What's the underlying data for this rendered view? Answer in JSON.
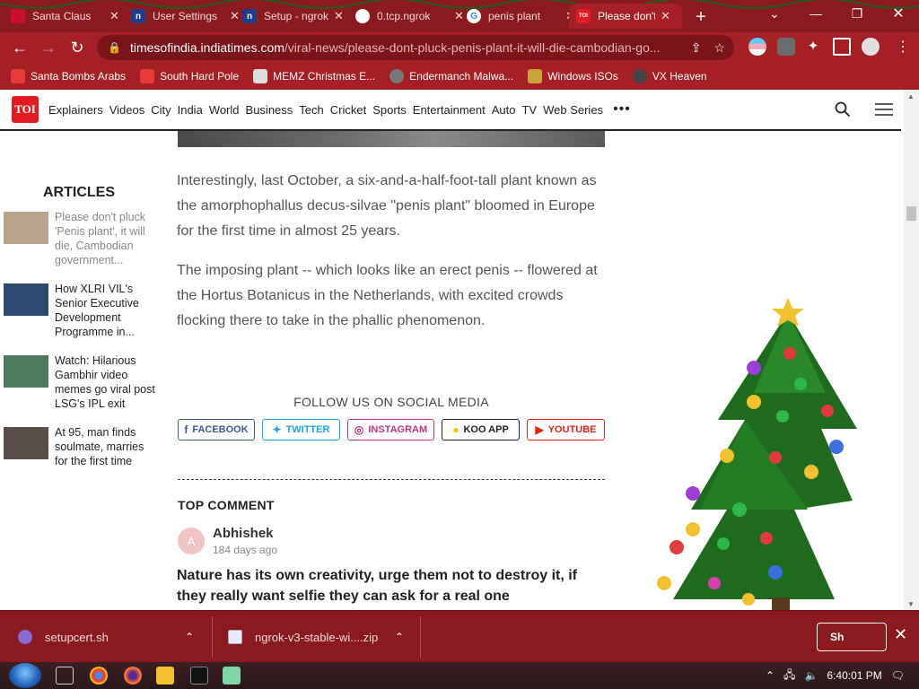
{
  "browser": {
    "tabs": [
      {
        "label": "Santa Claus",
        "fav_color": "#c8102e",
        "fav_text": ""
      },
      {
        "label": "User Settings",
        "fav_color": "#1f3b8c",
        "fav_text": "n"
      },
      {
        "label": "Setup - ngrok",
        "fav_color": "#1f3b8c",
        "fav_text": "n"
      },
      {
        "label": "0.tcp.ngrok",
        "fav_color": "#ffffff",
        "fav_text": ""
      },
      {
        "label": "penis plant",
        "fav_color": "#ffffff",
        "fav_text": "G"
      },
      {
        "label": "Please don't",
        "fav_color": "#e21b22",
        "fav_text": "TOI"
      }
    ],
    "url_domain": "timesofindia.indiatimes.com",
    "url_path": "/viral-news/please-dont-pluck-penis-plant-it-will-die-cambodian-go...",
    "bookmarks": [
      {
        "label": "Santa Bombs Arabs",
        "color": "#e63b3b"
      },
      {
        "label": "South Hard Pole",
        "color": "#e63b3b"
      },
      {
        "label": "MEMZ Christmas E...",
        "color": "#ddd"
      },
      {
        "label": "Endermanch Malwa...",
        "color": "#777"
      },
      {
        "label": "Windows ISOs",
        "color": "#c9a23a"
      },
      {
        "label": "VX Heaven",
        "color": "#444"
      }
    ],
    "colors": {
      "frame": "#8b1a1e",
      "toolbar": "#a51f24",
      "omnibox": "#7a1418"
    }
  },
  "site": {
    "logo_text": "TOI",
    "nav": [
      "Explainers",
      "Videos",
      "City",
      "India",
      "World",
      "Business",
      "Tech",
      "Cricket",
      "Sports",
      "Entertainment",
      "Auto",
      "TV",
      "Web Series"
    ],
    "more_label": "•••",
    "brand_color": "#e21b22"
  },
  "sidebar": {
    "title": "ARTICLES",
    "items": [
      {
        "text": "Please don't pluck 'Penis plant', it will die, Cambodian government...",
        "thumb": "#b9a58a"
      },
      {
        "text": "How XLRI VIL's Senior Executive Development Programme in...",
        "thumb": "#2d4b6e"
      },
      {
        "text": "Watch: Hilarious Gambhir video memes go viral post LSG's IPL exit",
        "thumb": "#4d7a5c"
      },
      {
        "text": "At 95, man finds soulmate, marries for the first time",
        "thumb": "#5a4e4a"
      }
    ]
  },
  "article": {
    "paragraphs": [
      "Interestingly, last October, a six-and-a-half-foot-tall plant known as the amorphophallus decus-silvae \"penis plant\" bloomed in Europe for the first time in almost 25 years.",
      "The imposing plant -- which looks like an erect penis -- flowered at the Hortus Botanicus in the Netherlands, with excited crowds flocking there to take in the phallic phenomenon."
    ],
    "follow_label": "FOLLOW US ON SOCIAL MEDIA",
    "social": [
      {
        "label": "FACEBOOK",
        "icon": "f",
        "color": "#3b5998"
      },
      {
        "label": "TWITTER",
        "icon": "🐦",
        "color": "#1da1f2"
      },
      {
        "label": "INSTAGRAM",
        "icon": "◎",
        "color": "#c13584"
      },
      {
        "label": "KOO APP",
        "icon": "●",
        "color": "#222222"
      },
      {
        "label": "YOUTUBE",
        "icon": "▶",
        "color": "#e62117"
      }
    ],
    "top_comment_label": "TOP COMMENT",
    "comment": {
      "avatar_letter": "A",
      "author": "Abhishek",
      "time": "184 days ago",
      "text": "Nature has its own creativity, urge them not to destroy it, if they really want selfie they can ask for a real one"
    }
  },
  "downloads": {
    "items": [
      {
        "name": "setupcert.sh",
        "icon_color": "#8a6bd1"
      },
      {
        "name": "ngrok-v3-stable-wi....zip",
        "icon_color": "#e8e8ff"
      }
    ],
    "show_all_label": "Sh"
  },
  "taskbar": {
    "clock": "6:40:01 PM"
  }
}
